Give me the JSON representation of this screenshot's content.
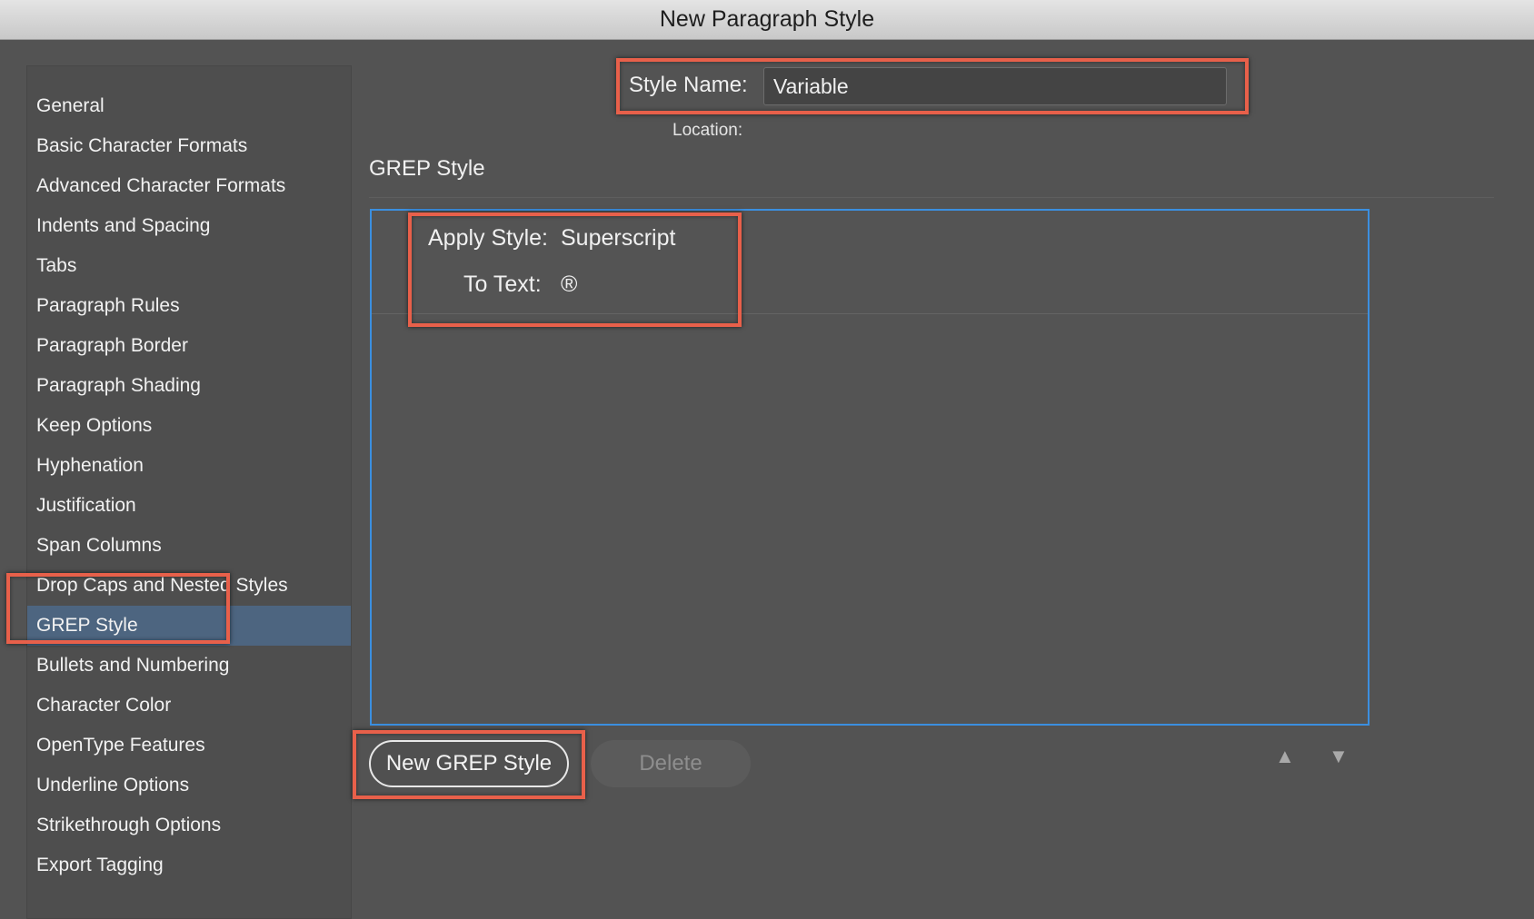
{
  "window": {
    "title": "New Paragraph Style"
  },
  "sidebar": {
    "items": [
      {
        "label": "General"
      },
      {
        "label": "Basic Character Formats"
      },
      {
        "label": "Advanced Character Formats"
      },
      {
        "label": "Indents and Spacing"
      },
      {
        "label": "Tabs"
      },
      {
        "label": "Paragraph Rules"
      },
      {
        "label": "Paragraph Border"
      },
      {
        "label": "Paragraph Shading"
      },
      {
        "label": "Keep Options"
      },
      {
        "label": "Hyphenation"
      },
      {
        "label": "Justification"
      },
      {
        "label": "Span Columns"
      },
      {
        "label": "Drop Caps and Nested Styles"
      },
      {
        "label": "GREP Style",
        "selected": true
      },
      {
        "label": "Bullets and Numbering"
      },
      {
        "label": "Character Color"
      },
      {
        "label": "OpenType Features"
      },
      {
        "label": "Underline Options"
      },
      {
        "label": "Strikethrough Options"
      },
      {
        "label": "Export Tagging"
      }
    ]
  },
  "header": {
    "style_name_label": "Style Name:",
    "style_name_value": "Variable",
    "location_label": "Location:"
  },
  "section": {
    "title": "GREP Style"
  },
  "grep_styles": [
    {
      "apply_style_label": "Apply Style:",
      "apply_style_value": "Superscript",
      "to_text_label": "To Text:",
      "to_text_value": "®"
    }
  ],
  "buttons": {
    "new_grep_style": "New GREP Style",
    "delete": "Delete"
  },
  "icons": {
    "move_up": "triangle-up-icon",
    "move_down": "triangle-down-icon"
  },
  "colors": {
    "highlight": "#e8604a",
    "selection": "#4d6580",
    "list_border": "#3b8fe0",
    "background": "#535353"
  }
}
